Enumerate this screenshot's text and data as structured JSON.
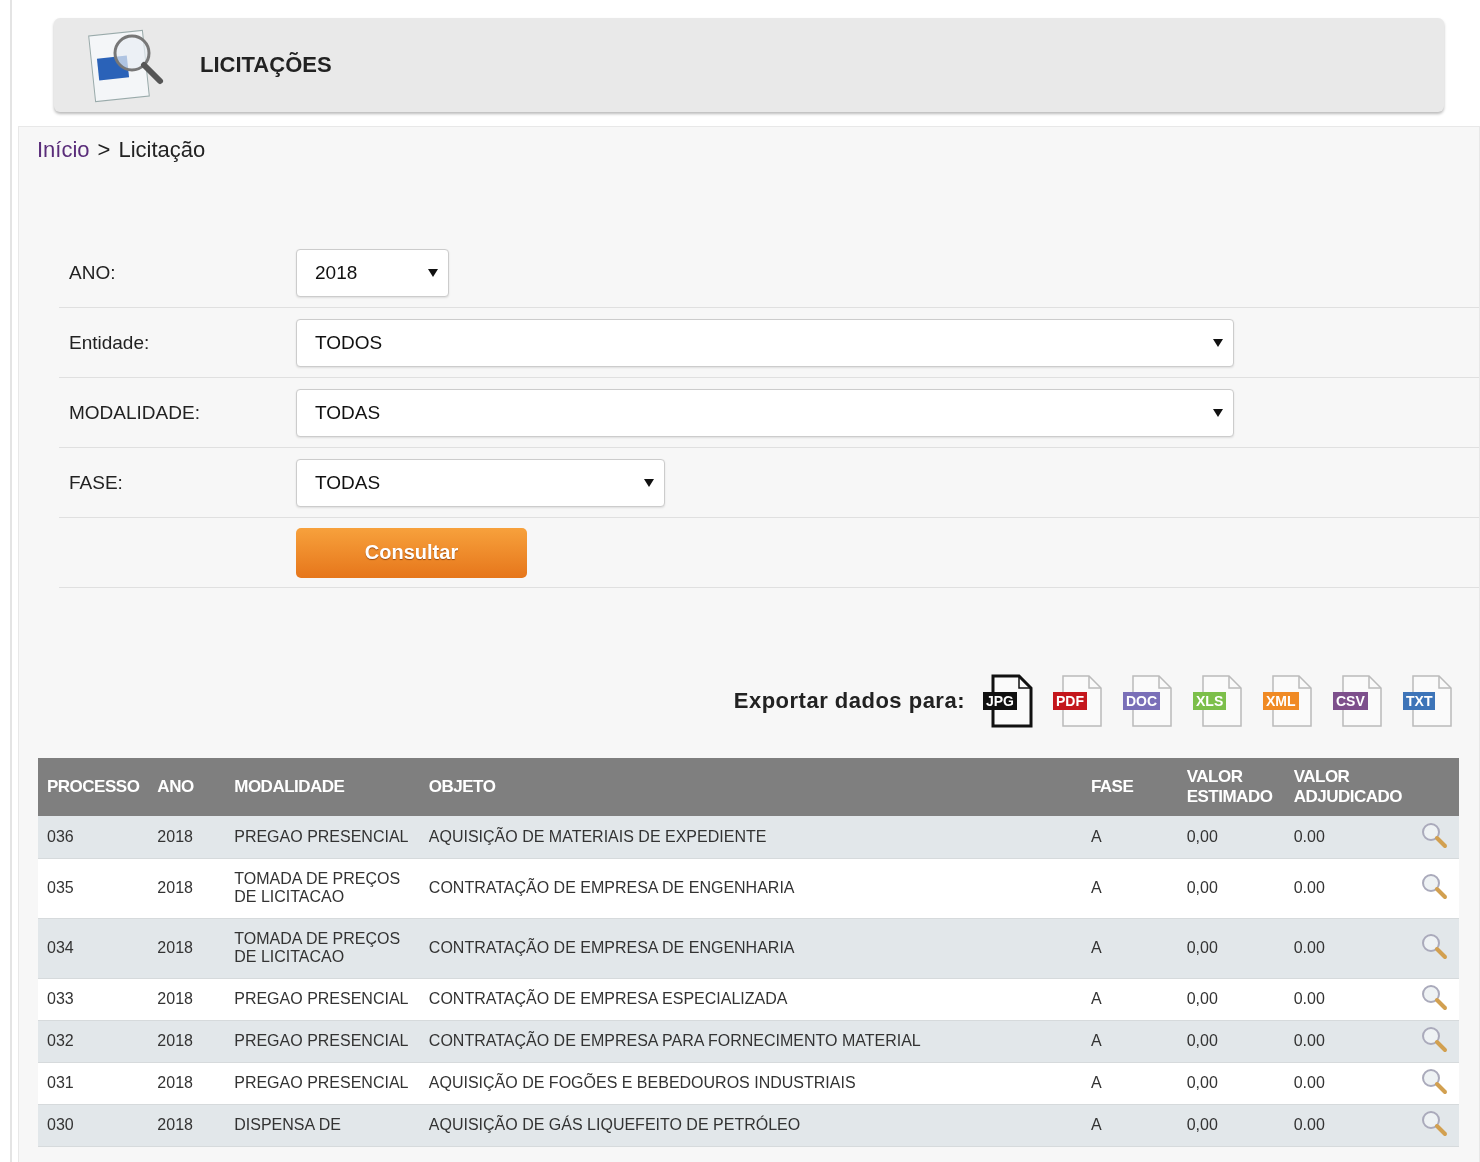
{
  "header": {
    "title": "LICITAÇÕES"
  },
  "breadcrumb": {
    "link": "Início",
    "separator": ">",
    "current": "Licitação"
  },
  "filters": [
    {
      "label": "ANO:",
      "value": "2018"
    },
    {
      "label": "Entidade:",
      "value": "TODOS"
    },
    {
      "label": "MODALIDADE:",
      "value": "TODAS"
    },
    {
      "label": "FASE:",
      "value": "TODAS"
    }
  ],
  "submit": "Consultar",
  "export": {
    "label": "Exportar dados para:",
    "formats": [
      {
        "label": "JPG",
        "color": "#111111"
      },
      {
        "label": "PDF",
        "color": "#c4161c"
      },
      {
        "label": "DOC",
        "color": "#7a6fb8"
      },
      {
        "label": "XLS",
        "color": "#7cbf4a"
      },
      {
        "label": "XML",
        "color": "#f08a24"
      },
      {
        "label": "CSV",
        "color": "#7d4f8c"
      },
      {
        "label": "TXT",
        "color": "#3d74b8"
      }
    ]
  },
  "table": {
    "columns": [
      "PROCESSO",
      "ANO",
      "MODALIDADE",
      "OBJETO",
      "FASE",
      "VALOR ESTIMADO",
      "VALOR ADJUDICADO"
    ],
    "rows": [
      {
        "processo": "036",
        "ano": "2018",
        "modalidade": "PREGAO PRESENCIAL",
        "objeto": "AQUISIÇÃO DE MATERIAIS DE EXPEDIENTE",
        "fase": "A",
        "estimado": "0,00",
        "adjudicado": "0.00"
      },
      {
        "processo": "035",
        "ano": "2018",
        "modalidade": "TOMADA DE PREÇOS DE LICITACAO",
        "objeto": "CONTRATAÇÃO DE EMPRESA DE ENGENHARIA",
        "fase": "A",
        "estimado": "0,00",
        "adjudicado": "0.00"
      },
      {
        "processo": "034",
        "ano": "2018",
        "modalidade": "TOMADA DE PREÇOS DE LICITACAO",
        "objeto": "CONTRATAÇÃO DE EMPRESA DE ENGENHARIA",
        "fase": "A",
        "estimado": "0,00",
        "adjudicado": "0.00"
      },
      {
        "processo": "033",
        "ano": "2018",
        "modalidade": "PREGAO PRESENCIAL",
        "objeto": "CONTRATAÇÃO DE EMPRESA ESPECIALIZADA",
        "fase": "A",
        "estimado": "0,00",
        "adjudicado": "0.00"
      },
      {
        "processo": "032",
        "ano": "2018",
        "modalidade": "PREGAO PRESENCIAL",
        "objeto": "CONTRATAÇÃO DE EMPRESA PARA FORNECIMENTO MATERIAL",
        "fase": "A",
        "estimado": "0,00",
        "adjudicado": "0.00"
      },
      {
        "processo": "031",
        "ano": "2018",
        "modalidade": "PREGAO PRESENCIAL",
        "objeto": "AQUISIÇÃO DE FOGÕES E BEBEDOUROS INDUSTRIAIS",
        "fase": "A",
        "estimado": "0,00",
        "adjudicado": "0.00"
      },
      {
        "processo": "030",
        "ano": "2018",
        "modalidade": "DISPENSA DE",
        "objeto": "AQUISIÇÃO DE GÁS LIQUEFEITO DE PETRÓLEO",
        "fase": "A",
        "estimado": "0,00",
        "adjudicado": "0.00"
      }
    ]
  }
}
